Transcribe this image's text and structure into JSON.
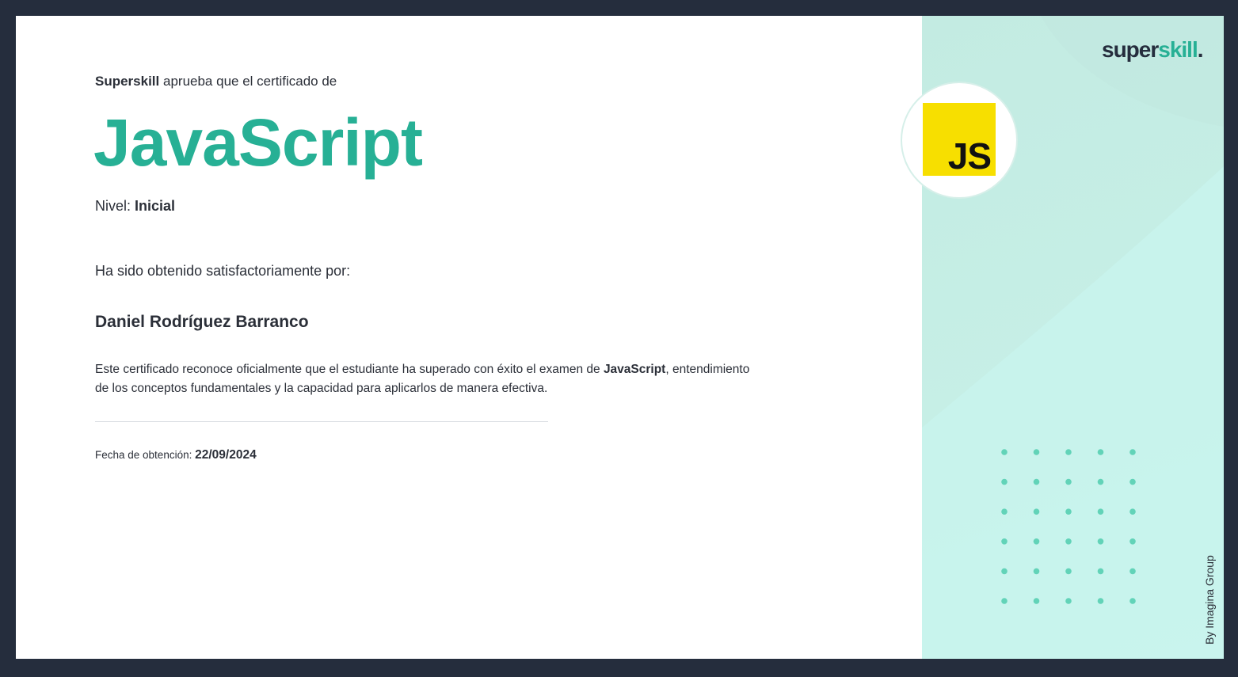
{
  "certificate": {
    "issuer_name": "Superskill",
    "issuer_phrase": "aprueba que el certificado de",
    "course_title": "JavaScript",
    "level_label": "Nivel:",
    "level_value": "Inicial",
    "obtained_text": "Ha sido obtenido satisfactoriamente por:",
    "student_name": "Daniel Rodríguez Barranco",
    "description_prefix": "Este certificado reconoce oficialmente que el estudiante ha superado con éxito el examen de",
    "description_course": "JavaScript",
    "description_suffix": ", entendimiento de los conceptos fundamentales y la capacidad para aplicarlos de manera efectiva.",
    "date_label": "Fecha de obtención:",
    "date_value": "22/09/2024"
  },
  "brand": {
    "part1": "super",
    "part2": "skill",
    "dot": "."
  },
  "badge": {
    "icon": "javascript-logo-icon",
    "text": "JS"
  },
  "side": {
    "credit": "By Imagina Group"
  },
  "colors": {
    "accent": "#27b095",
    "frame": "#252d3d",
    "panel": "#c6efe6",
    "js_yellow": "#f7df00",
    "dots": "#62d3b8"
  }
}
